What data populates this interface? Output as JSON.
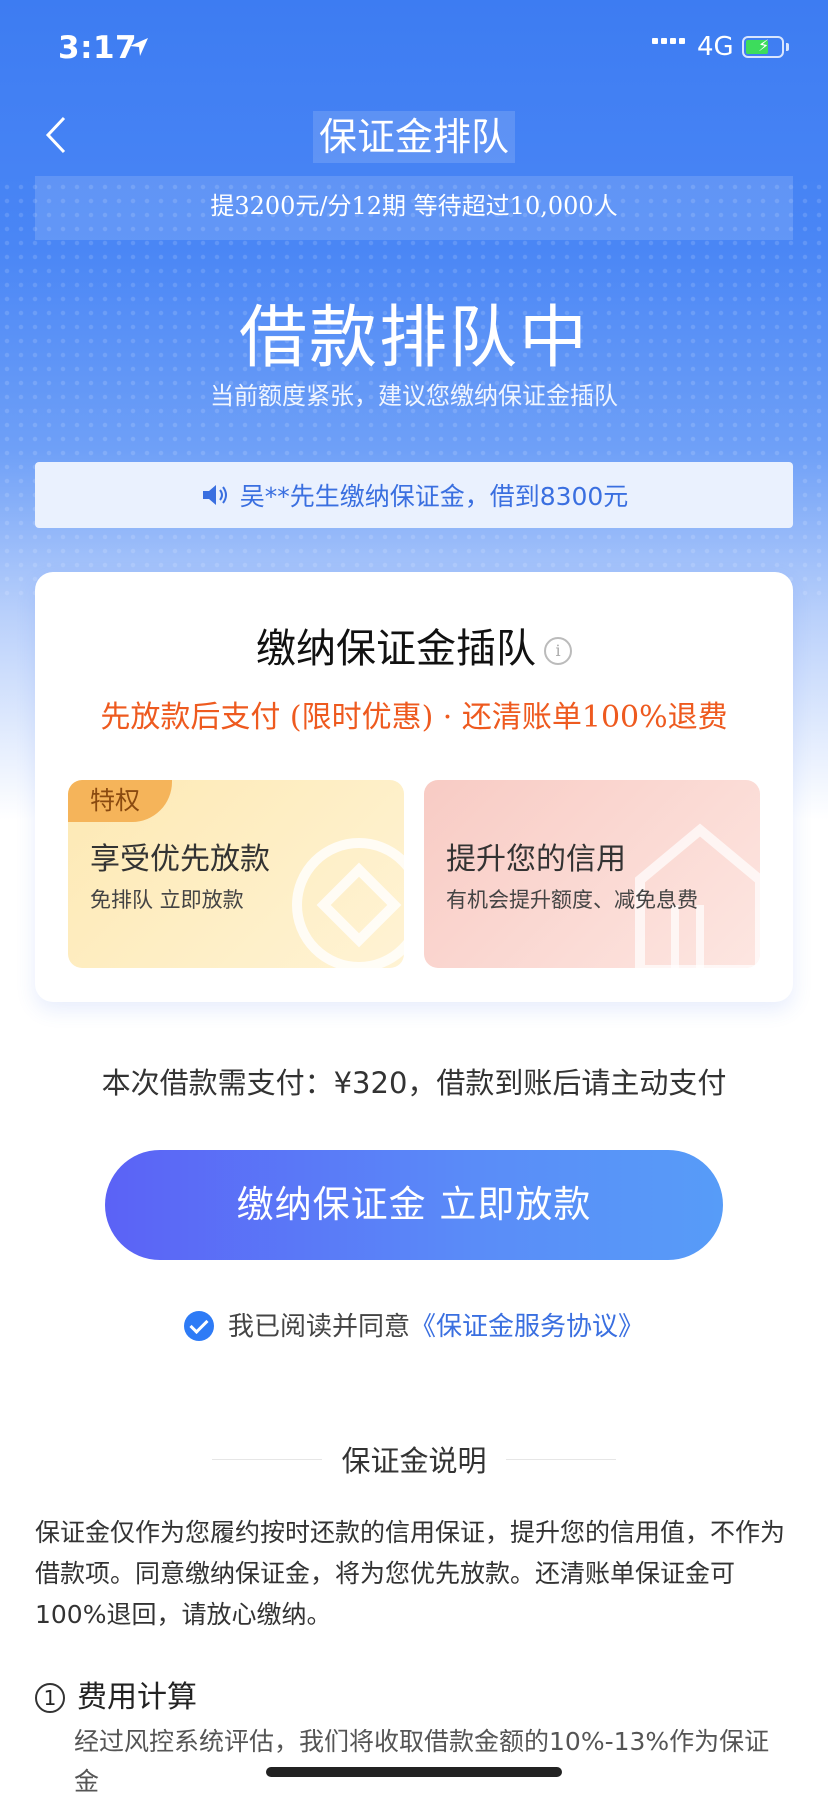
{
  "status_bar": {
    "time": "3:17",
    "network": "4G"
  },
  "nav": {
    "title": "保证金排队"
  },
  "top_notice": "提3200元/分12期 等待超过10,000人",
  "hero": {
    "headline": "借款排队中",
    "subline": "当前额度紧张，建议您缴纳保证金插队"
  },
  "ticker": "吴**先生缴纳保证金，借到8300元",
  "card": {
    "title": "缴纳保证金插队",
    "subtitle": "先放款后支付 (限时优惠) · 还清账单100%退费",
    "perks": [
      {
        "badge": "特权",
        "title": "享受优先放款",
        "desc": "免排队  立即放款"
      },
      {
        "title": "提升您的信用",
        "desc": "有机会提升额度、减免息费"
      }
    ]
  },
  "pay_note": "本次借款需支付：¥320，借款到账后请主动支付",
  "cta_label": "缴纳保证金 立即放款",
  "agreement": {
    "prefix": "我已阅读并同意",
    "link": "《保证金服务协议》"
  },
  "explanation": {
    "title": "保证金说明",
    "paragraph": "保证金仅作为您履约按时还款的信用保证，提升您的信用值，不作为借款项。同意缴纳保证金，将为您优先放款。还清账单保证金可100%退回，请放心缴纳。",
    "items": [
      {
        "number": "1",
        "title": "费用计算",
        "desc": "经过风控系统评估，我们将收取借款金额的10%-13%作为保证金"
      }
    ]
  },
  "colors": {
    "primary_blue": "#3d7cf2",
    "accent_orange": "#ee5a1f",
    "link_blue": "#3a6fe0",
    "check_blue": "#2e7bf6"
  }
}
